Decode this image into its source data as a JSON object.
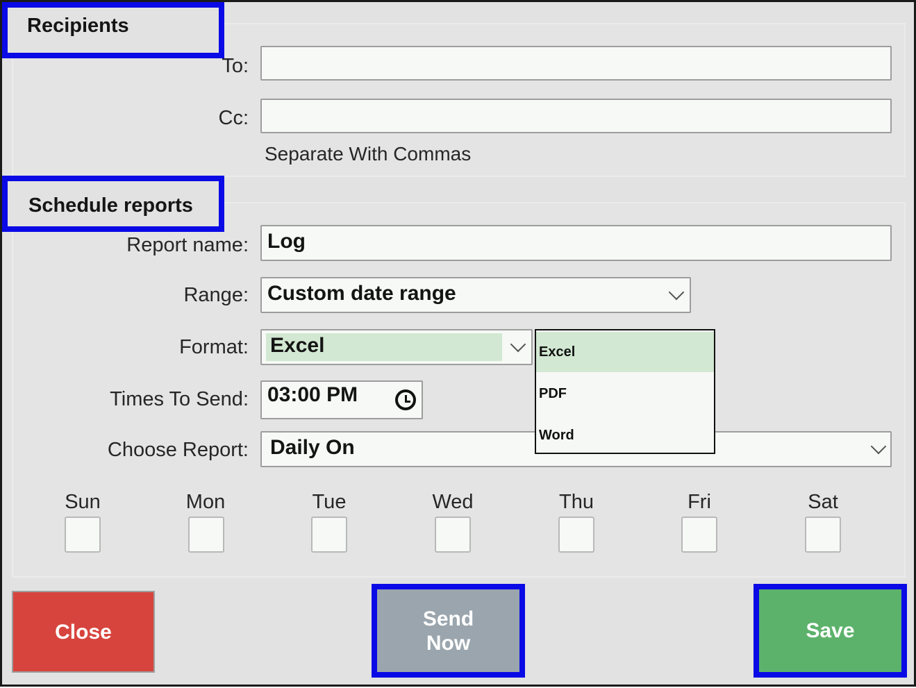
{
  "recipients": {
    "title": "Recipients",
    "to_label": "To:",
    "to_value": "",
    "cc_label": "Cc:",
    "cc_value": "",
    "hint": "Separate With Commas"
  },
  "schedule": {
    "title": "Schedule reports",
    "report_name_label": "Report name:",
    "report_name_value": "Log",
    "range_label": "Range:",
    "range_value": "Custom date range",
    "format_label": "Format:",
    "format_value": "Excel",
    "format_options": [
      "Excel",
      "PDF",
      "Word"
    ],
    "times_label": "Times To Send:",
    "times_value": "03:00 PM",
    "choose_report_label": "Choose Report:",
    "choose_report_value": "Daily On",
    "days": [
      "Sun",
      "Mon",
      "Tue",
      "Wed",
      "Thu",
      "Fri",
      "Sat"
    ]
  },
  "buttons": {
    "close": "Close",
    "send_now_line1": "Send",
    "send_now_line2": "Now",
    "save": "Save"
  },
  "colors": {
    "highlight_border": "#0a0ae6",
    "close_bg": "#d7443d",
    "send_bg": "#9aa5ad",
    "save_bg": "#5db26b",
    "selected_option_bg": "#d2e8d2"
  },
  "icons": {
    "range_dropdown": "chevron-down-icon",
    "format_dropdown": "chevron-down-icon",
    "choose_report_dropdown": "chevron-down-icon",
    "time_picker": "clock-icon"
  }
}
